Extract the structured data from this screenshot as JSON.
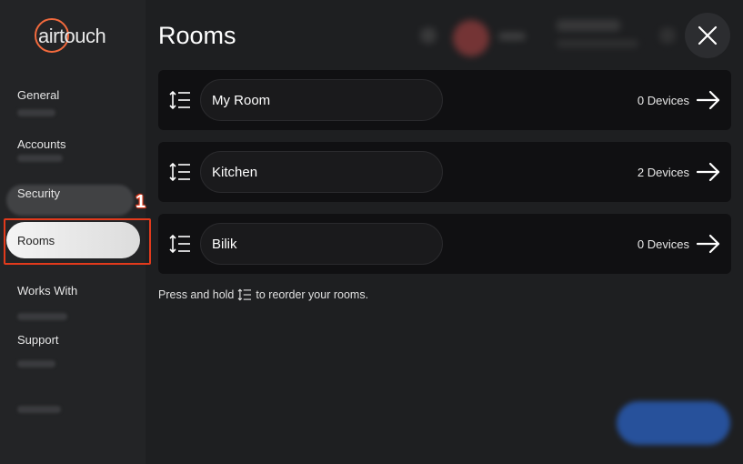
{
  "app": {
    "logo_text": "airtouch"
  },
  "sidebar": {
    "items": [
      {
        "label": "General"
      },
      {
        "label": "Accounts"
      },
      {
        "label": "Security"
      },
      {
        "label": "Rooms",
        "selected": true
      },
      {
        "label": "Works With"
      },
      {
        "label": "Support"
      }
    ]
  },
  "annotation": {
    "number": "1",
    "color": "#e23a1c"
  },
  "page": {
    "title": "Rooms"
  },
  "rooms": [
    {
      "name": "My Room",
      "devices": "0 Devices"
    },
    {
      "name": "Kitchen",
      "devices": "2 Devices"
    },
    {
      "name": "Bilik",
      "devices": "0 Devices"
    }
  ],
  "hint": {
    "before": "Press and hold",
    "after": "to reorder your rooms."
  },
  "icons": {
    "close": "close-icon",
    "reorder": "reorder-icon",
    "arrow": "arrow-right-icon"
  },
  "colors": {
    "accent": "#f26a3d",
    "background": "#1e1f21",
    "card": "#101012"
  }
}
